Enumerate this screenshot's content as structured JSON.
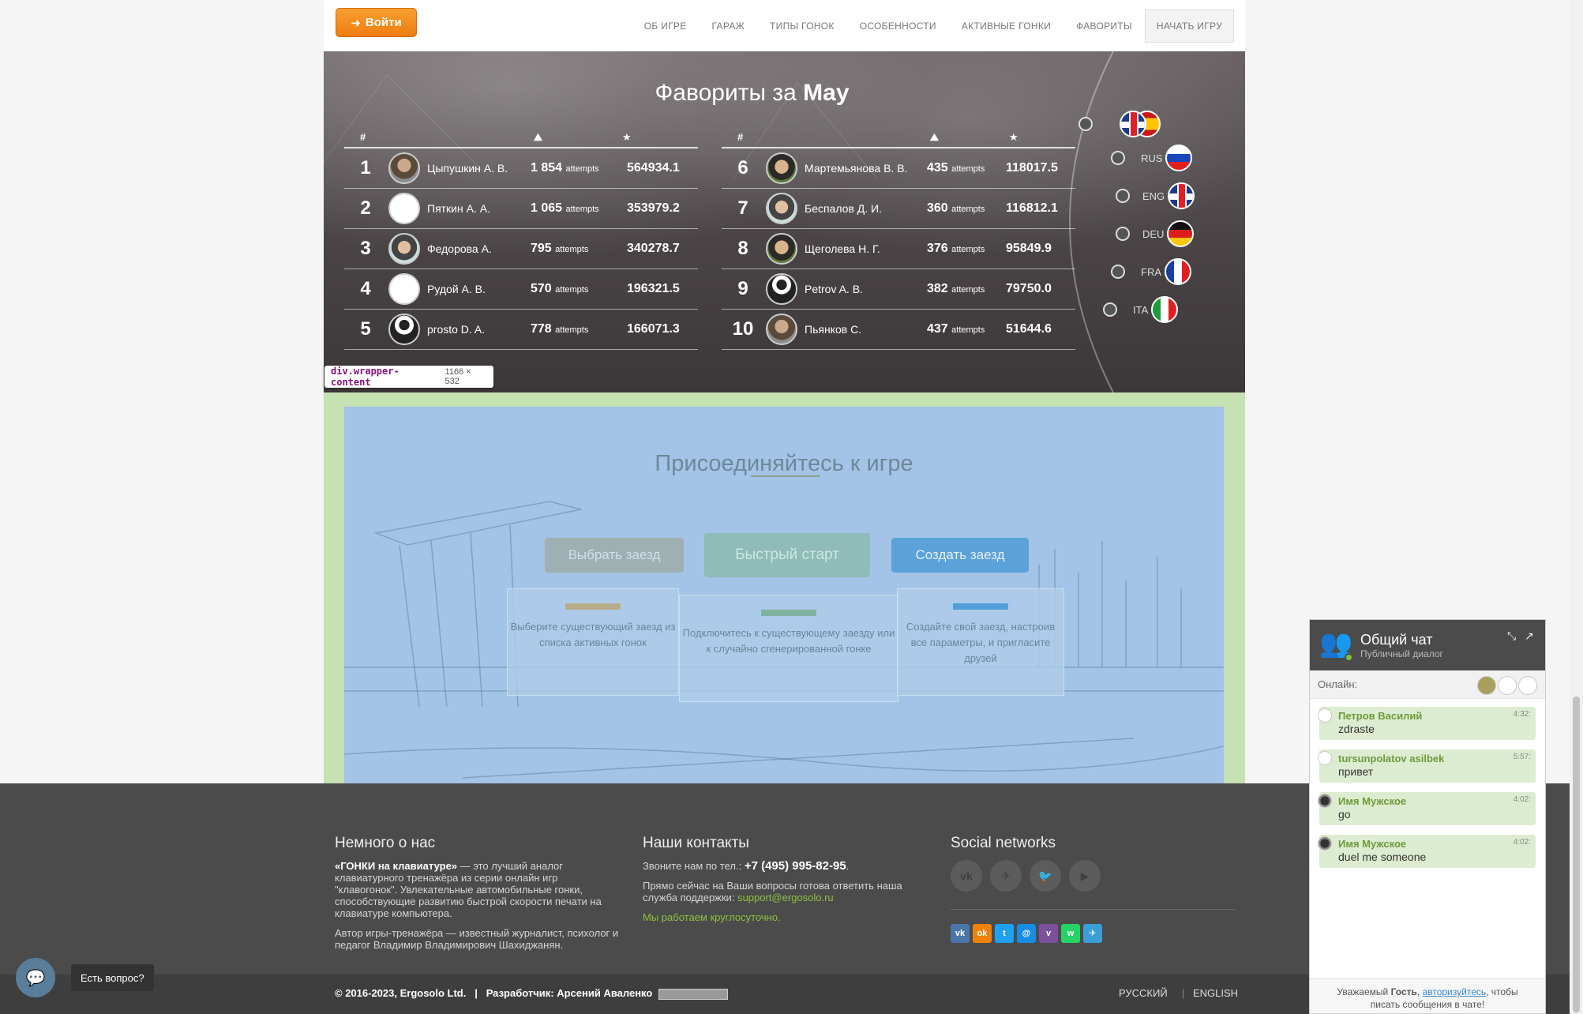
{
  "header": {
    "login_label": "Войти",
    "nav": [
      "ОБ ИГРЕ",
      "ГАРАЖ",
      "ТИПЫ ГОНОК",
      "ОСОБЕННОСТИ",
      "АКТИВНЫЕ ГОНКИ",
      "ФАВОРИТЫ",
      "НАЧАТЬ ИГРУ"
    ]
  },
  "favorites": {
    "title_prefix": "Фавориты за",
    "title_month": "May",
    "col_rank": "#",
    "attempts_unit": "attempts",
    "left": [
      {
        "rank": "1",
        "name": "Цыпушкин А. В.",
        "attempts": "1 854",
        "score": "564934.1"
      },
      {
        "rank": "2",
        "name": "Пяткин А. А.",
        "attempts": "1 065",
        "score": "353979.2"
      },
      {
        "rank": "3",
        "name": "Федорова А.",
        "attempts": "795",
        "score": "340278.7"
      },
      {
        "rank": "4",
        "name": "Рудой А. В.",
        "attempts": "570",
        "score": "196321.5"
      },
      {
        "rank": "5",
        "name": "prosto D. A.",
        "attempts": "778",
        "score": "166071.3"
      }
    ],
    "right": [
      {
        "rank": "6",
        "name": "Мартемьянова В. В.",
        "attempts": "435",
        "score": "118017.5"
      },
      {
        "rank": "7",
        "name": "Беспалов Д. И.",
        "attempts": "360",
        "score": "116812.1"
      },
      {
        "rank": "8",
        "name": "Щеголева Н. Г.",
        "attempts": "376",
        "score": "95849.9"
      },
      {
        "rank": "9",
        "name": "Petrov A. B.",
        "attempts": "382",
        "score": "79750.0"
      },
      {
        "rank": "10",
        "name": "Пьянков С.",
        "attempts": "437",
        "score": "51644.6"
      }
    ],
    "languages": [
      "RUS",
      "ENG",
      "DEU",
      "FRA",
      "ITA"
    ]
  },
  "devtools": {
    "tag": "div.wrapper-content",
    "dims": "1166 × 532"
  },
  "join": {
    "title": "Присоединяйтесь к игре",
    "btn_choose": "Выбрать заезд",
    "btn_quick": "Быстрый старт",
    "btn_create": "Создать заезд",
    "card1": "Выберите существующий заезд из списка активных гонок",
    "card2": "Подключитесь к существующему заезду или к случайно сгенерированной гонке",
    "card3": "Создайте свой заезд, настроив все параметры, и пригласите друзей"
  },
  "footer": {
    "about_title": "Немного о нас",
    "about_brand": "«ГОНКИ на клавиатуре»",
    "about_text": " — это лучший аналог клавиатурного тренажёра из серии онлайн игр \"клавогонок\". Увлекательные автомобильные гонки, способствующие развитию быстрой скорости печати на клавиатуре компьютера.",
    "about_author": "Автор игры-тренажёра — известный журналист, психолог и педагог Владимир Владимирович Шахиджанян.",
    "contacts_title": "Наши контакты",
    "phone_prefix": "Звоните нам по тел.:",
    "phone": "+7 (495) 995-82-95",
    "support_text": "Прямо сейчас на Ваши вопросы готова ответить наша служба поддержки:",
    "email": "support@ergosolo.ru",
    "hours": "Мы работаем круглосуточно.",
    "social_title": "Social networks",
    "copyright": "© 2016-2023, Ergosolo Ltd.",
    "separator": "|",
    "developer": "Разработчик: Арсений Аваленко",
    "lang_ru": "РУССКИЙ",
    "lang_en": "ENGLISH"
  },
  "help": {
    "label": "Есть вопрос?"
  },
  "chat": {
    "title": "Общий чат",
    "subtitle": "Публичный диалог",
    "online_label": "Онлайн:",
    "messages": [
      {
        "author": "Петров Василий",
        "time": "4:32:",
        "text": "zdraste"
      },
      {
        "author": "tursunpolatov asilbek",
        "time": "5:57:",
        "text": "привет"
      },
      {
        "author": "Имя Мужское",
        "time": "4:02:",
        "text": "go"
      },
      {
        "author": "Имя Мужское",
        "time": "4:02:",
        "text": "duel me someone"
      }
    ],
    "footer_prefix": "Уважаемый",
    "footer_guest": "Гость",
    "footer_link": "авторизуйтесь",
    "footer_suffix": ", чтобы писать сообщения в чате!"
  }
}
